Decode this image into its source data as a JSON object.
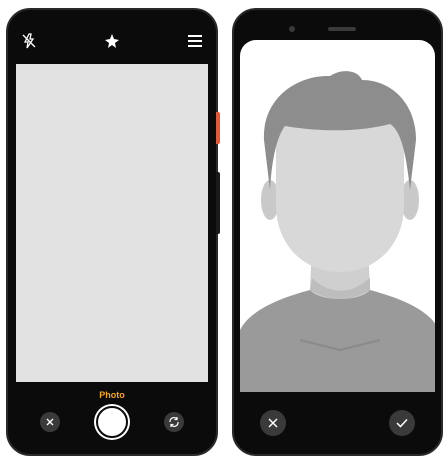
{
  "left_phone": {
    "top_icons": [
      "flash-off-icon",
      "auto-enhance-icon",
      "menu-icon"
    ],
    "mode_label": "Photo",
    "left_control_icon": "close-icon",
    "right_control_icon": "switch-camera-icon",
    "accent_color": "#f5a623"
  },
  "right_phone": {
    "preview_image": "person-silhouette",
    "cancel_icon": "close-icon",
    "confirm_icon": "check-icon"
  }
}
